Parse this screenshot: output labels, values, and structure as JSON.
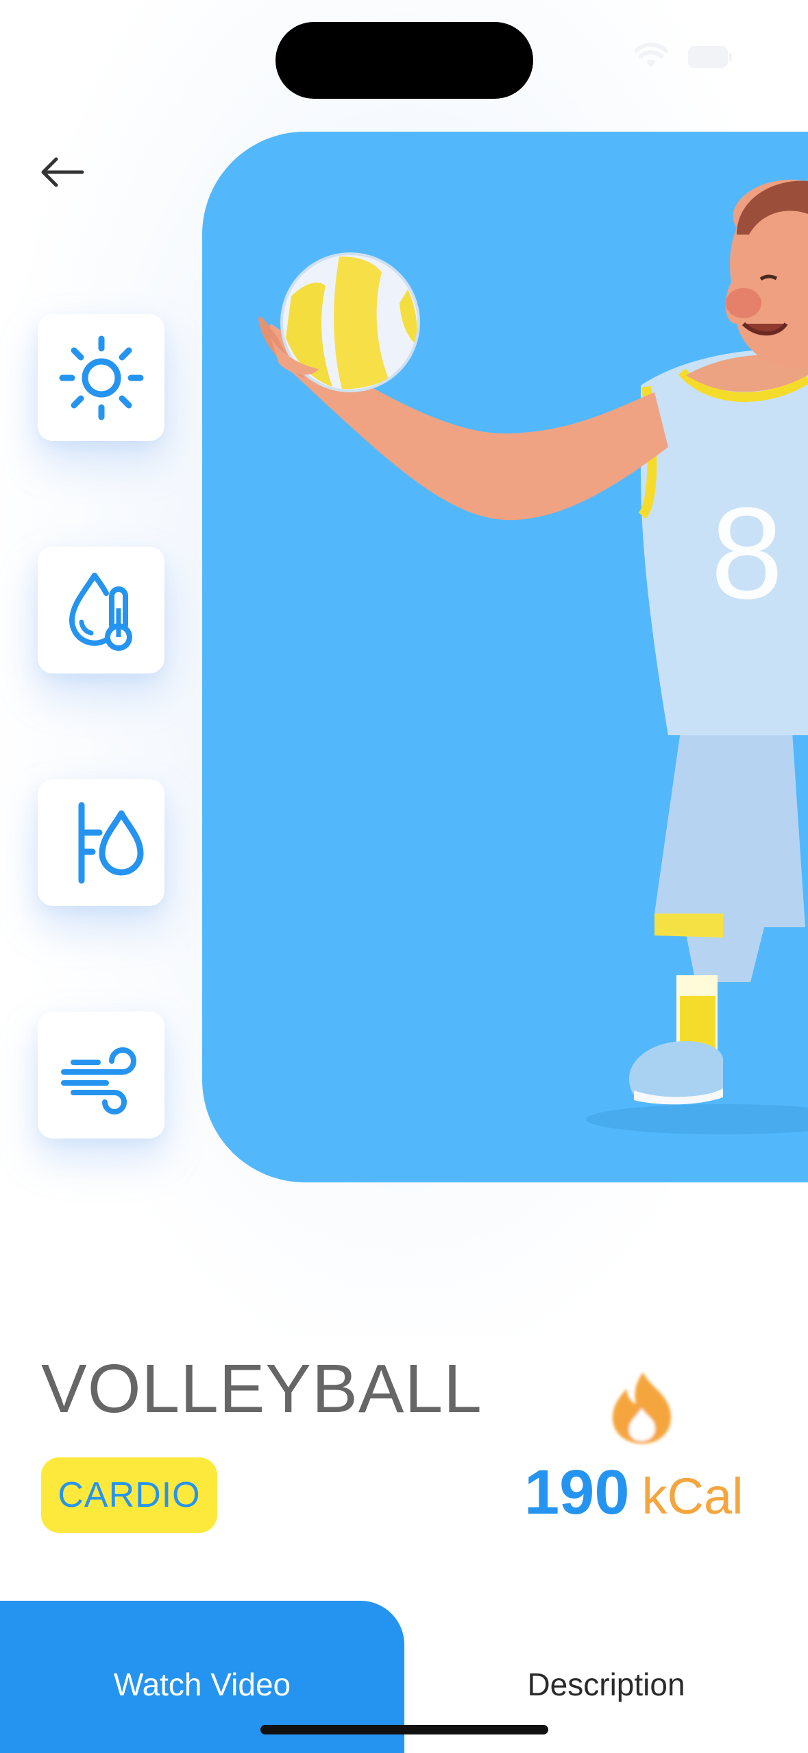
{
  "activity": {
    "name": "VOLLEYBALL",
    "category": "CARDIO",
    "calories_value": "190",
    "calories_unit": "kCal"
  },
  "hero": {
    "jersey_number": "8",
    "background_color": "#53b8fb"
  },
  "side_icons": [
    "sun-icon",
    "humidity-temperature-icon",
    "water-level-icon",
    "wind-icon"
  ],
  "tabs": {
    "watch_video": "Watch Video",
    "description": "Description",
    "active": "watch_video"
  },
  "colors": {
    "accent_blue": "#2594f0",
    "tag_yellow": "#fde93b",
    "calorie_orange": "#f5a53e"
  }
}
